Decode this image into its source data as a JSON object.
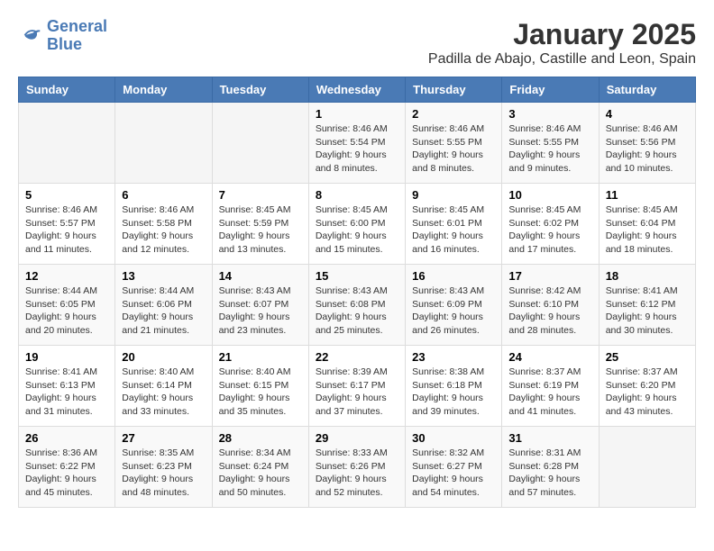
{
  "logo": {
    "line1": "General",
    "line2": "Blue"
  },
  "title": "January 2025",
  "subtitle": "Padilla de Abajo, Castille and Leon, Spain",
  "weekdays": [
    "Sunday",
    "Monday",
    "Tuesday",
    "Wednesday",
    "Thursday",
    "Friday",
    "Saturday"
  ],
  "weeks": [
    [
      {
        "day": "",
        "info": ""
      },
      {
        "day": "",
        "info": ""
      },
      {
        "day": "",
        "info": ""
      },
      {
        "day": "1",
        "info": "Sunrise: 8:46 AM\nSunset: 5:54 PM\nDaylight: 9 hours\nand 8 minutes."
      },
      {
        "day": "2",
        "info": "Sunrise: 8:46 AM\nSunset: 5:55 PM\nDaylight: 9 hours\nand 8 minutes."
      },
      {
        "day": "3",
        "info": "Sunrise: 8:46 AM\nSunset: 5:55 PM\nDaylight: 9 hours\nand 9 minutes."
      },
      {
        "day": "4",
        "info": "Sunrise: 8:46 AM\nSunset: 5:56 PM\nDaylight: 9 hours\nand 10 minutes."
      }
    ],
    [
      {
        "day": "5",
        "info": "Sunrise: 8:46 AM\nSunset: 5:57 PM\nDaylight: 9 hours\nand 11 minutes."
      },
      {
        "day": "6",
        "info": "Sunrise: 8:46 AM\nSunset: 5:58 PM\nDaylight: 9 hours\nand 12 minutes."
      },
      {
        "day": "7",
        "info": "Sunrise: 8:45 AM\nSunset: 5:59 PM\nDaylight: 9 hours\nand 13 minutes."
      },
      {
        "day": "8",
        "info": "Sunrise: 8:45 AM\nSunset: 6:00 PM\nDaylight: 9 hours\nand 15 minutes."
      },
      {
        "day": "9",
        "info": "Sunrise: 8:45 AM\nSunset: 6:01 PM\nDaylight: 9 hours\nand 16 minutes."
      },
      {
        "day": "10",
        "info": "Sunrise: 8:45 AM\nSunset: 6:02 PM\nDaylight: 9 hours\nand 17 minutes."
      },
      {
        "day": "11",
        "info": "Sunrise: 8:45 AM\nSunset: 6:04 PM\nDaylight: 9 hours\nand 18 minutes."
      }
    ],
    [
      {
        "day": "12",
        "info": "Sunrise: 8:44 AM\nSunset: 6:05 PM\nDaylight: 9 hours\nand 20 minutes."
      },
      {
        "day": "13",
        "info": "Sunrise: 8:44 AM\nSunset: 6:06 PM\nDaylight: 9 hours\nand 21 minutes."
      },
      {
        "day": "14",
        "info": "Sunrise: 8:43 AM\nSunset: 6:07 PM\nDaylight: 9 hours\nand 23 minutes."
      },
      {
        "day": "15",
        "info": "Sunrise: 8:43 AM\nSunset: 6:08 PM\nDaylight: 9 hours\nand 25 minutes."
      },
      {
        "day": "16",
        "info": "Sunrise: 8:43 AM\nSunset: 6:09 PM\nDaylight: 9 hours\nand 26 minutes."
      },
      {
        "day": "17",
        "info": "Sunrise: 8:42 AM\nSunset: 6:10 PM\nDaylight: 9 hours\nand 28 minutes."
      },
      {
        "day": "18",
        "info": "Sunrise: 8:41 AM\nSunset: 6:12 PM\nDaylight: 9 hours\nand 30 minutes."
      }
    ],
    [
      {
        "day": "19",
        "info": "Sunrise: 8:41 AM\nSunset: 6:13 PM\nDaylight: 9 hours\nand 31 minutes."
      },
      {
        "day": "20",
        "info": "Sunrise: 8:40 AM\nSunset: 6:14 PM\nDaylight: 9 hours\nand 33 minutes."
      },
      {
        "day": "21",
        "info": "Sunrise: 8:40 AM\nSunset: 6:15 PM\nDaylight: 9 hours\nand 35 minutes."
      },
      {
        "day": "22",
        "info": "Sunrise: 8:39 AM\nSunset: 6:17 PM\nDaylight: 9 hours\nand 37 minutes."
      },
      {
        "day": "23",
        "info": "Sunrise: 8:38 AM\nSunset: 6:18 PM\nDaylight: 9 hours\nand 39 minutes."
      },
      {
        "day": "24",
        "info": "Sunrise: 8:37 AM\nSunset: 6:19 PM\nDaylight: 9 hours\nand 41 minutes."
      },
      {
        "day": "25",
        "info": "Sunrise: 8:37 AM\nSunset: 6:20 PM\nDaylight: 9 hours\nand 43 minutes."
      }
    ],
    [
      {
        "day": "26",
        "info": "Sunrise: 8:36 AM\nSunset: 6:22 PM\nDaylight: 9 hours\nand 45 minutes."
      },
      {
        "day": "27",
        "info": "Sunrise: 8:35 AM\nSunset: 6:23 PM\nDaylight: 9 hours\nand 48 minutes."
      },
      {
        "day": "28",
        "info": "Sunrise: 8:34 AM\nSunset: 6:24 PM\nDaylight: 9 hours\nand 50 minutes."
      },
      {
        "day": "29",
        "info": "Sunrise: 8:33 AM\nSunset: 6:26 PM\nDaylight: 9 hours\nand 52 minutes."
      },
      {
        "day": "30",
        "info": "Sunrise: 8:32 AM\nSunset: 6:27 PM\nDaylight: 9 hours\nand 54 minutes."
      },
      {
        "day": "31",
        "info": "Sunrise: 8:31 AM\nSunset: 6:28 PM\nDaylight: 9 hours\nand 57 minutes."
      },
      {
        "day": "",
        "info": ""
      }
    ]
  ]
}
